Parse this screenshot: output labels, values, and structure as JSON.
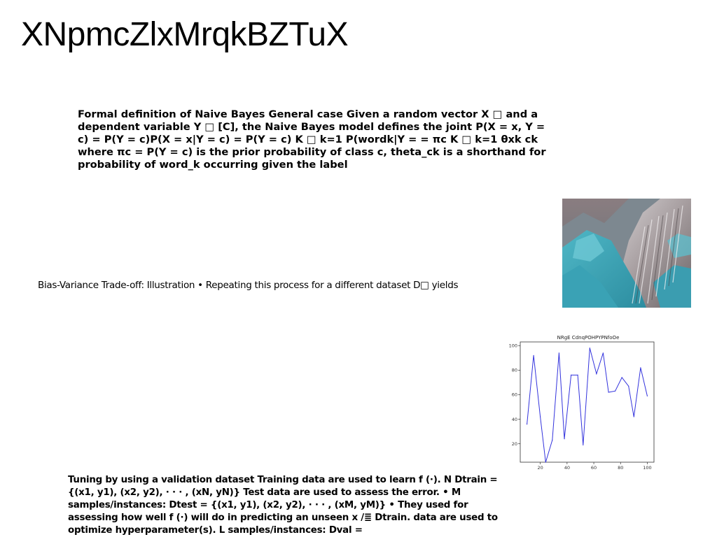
{
  "slide": {
    "title": "XNpmcZlxMrqkBZTuX",
    "paragraph1": "Formal definition of Naive Bayes General case Given a random vector X □ and a dependent variable Y □ [C], the Naive Bayes model defines the joint P(X = x, Y = c) = P(Y = c)P(X = x|Y = c) = P(Y = c) K □ k=1 P(wordk|Y = = πc K □ k=1 θxk ck where πc = P(Y = c) is the prior probability of class c, theta_ck is a shorthand for probability of word_k occurring given the label",
    "caption": "Bias-Variance Trade-off: Illustration • Repeating this process for a different dataset D□ yields",
    "paragraph2": "Tuning by using a validation dataset Training data are used to learn f (·). N Dtrain = {(x1, y1), (x2, y2), · · · , (xN, yN)} Test data are used to assess the error. • M samples/instances: Dtest = {(x1, y1), (x2, y2), · · · , (xM, yM)} • They used for assessing how well f (·) will do in predicting an unseen x /≣ Dtrain. data are used to optimize hyperparameter(s). L samples/instances: Dval ="
  },
  "chart_data": {
    "type": "line",
    "title": "NRgE CdnqPOHPYPNfoOe",
    "xlabel": "",
    "ylabel": "",
    "xlim": [
      5,
      105
    ],
    "ylim": [
      5,
      103
    ],
    "xticks": [
      20,
      40,
      60,
      80,
      100
    ],
    "yticks": [
      20,
      40,
      60,
      80,
      100
    ],
    "grid": false,
    "series": [
      {
        "color": "#3333dd",
        "x": [
          10,
          15,
          20,
          24,
          29,
          34,
          38,
          43,
          48,
          52,
          57,
          62,
          67,
          71,
          76,
          81,
          86,
          90,
          95,
          100
        ],
        "y": [
          36,
          92,
          42,
          5,
          23,
          94,
          24,
          76,
          76,
          19,
          98,
          77,
          94,
          62,
          63,
          74,
          67,
          42,
          82,
          59
        ]
      }
    ]
  }
}
